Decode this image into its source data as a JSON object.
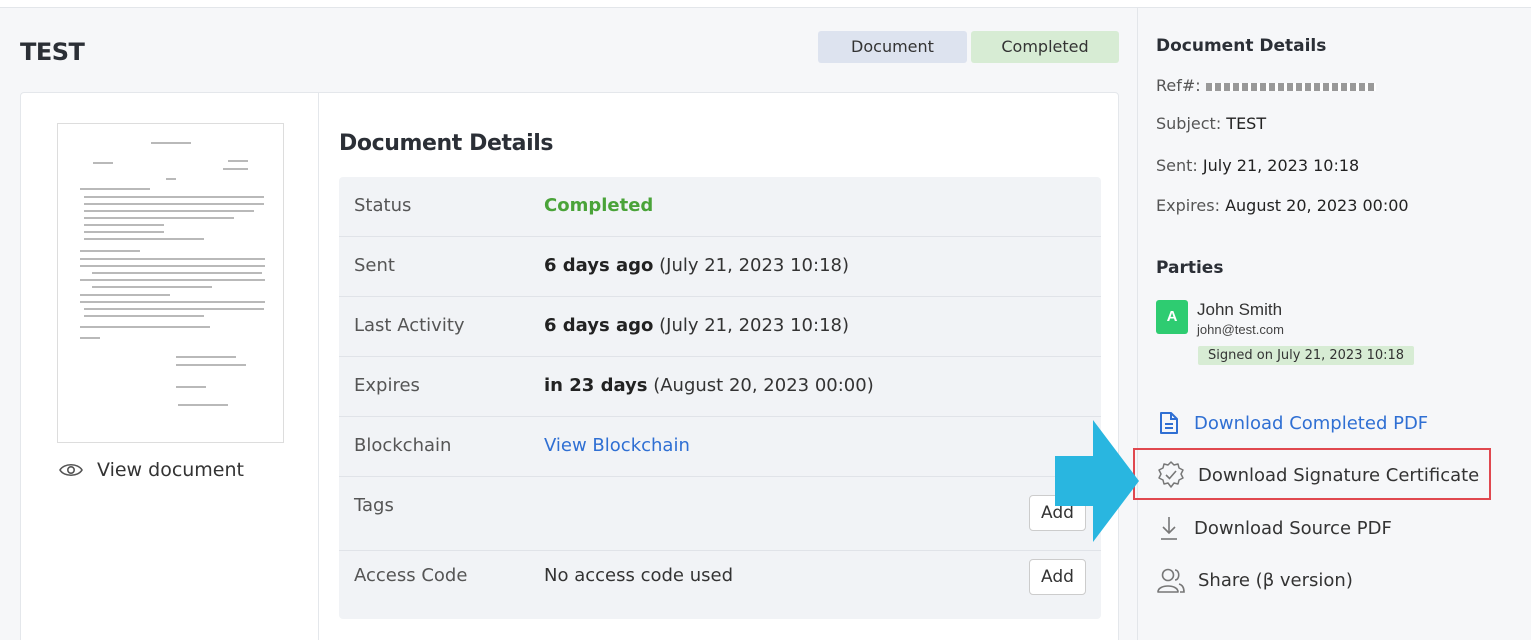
{
  "header": {
    "title": "TEST",
    "badge_type": "Document",
    "badge_status": "Completed"
  },
  "preview": {
    "view_label": "View document"
  },
  "details": {
    "heading": "Document Details",
    "rows": [
      {
        "label": "Status",
        "value": "Completed"
      },
      {
        "label": "Sent",
        "value_bold": "6 days ago",
        "value_rest": " (July 21, 2023 10:18)"
      },
      {
        "label": "Last Activity",
        "value_bold": "6 days ago",
        "value_rest": " (July 21, 2023 10:18)"
      },
      {
        "label": "Expires",
        "value_bold": "in 23 days",
        "value_rest": " (August 20, 2023 00:00)"
      },
      {
        "label": "Blockchain",
        "value": "View Blockchain"
      },
      {
        "label": "Tags",
        "button": "Add"
      },
      {
        "label": "Access Code",
        "value": "No access code used",
        "button": "Add"
      }
    ]
  },
  "sidebar": {
    "heading": "Document Details",
    "ref_label": "Ref#:",
    "subject_label": "Subject:",
    "subject_value": "TEST",
    "sent_label": "Sent:",
    "sent_value": "July 21, 2023 10:18",
    "expires_label": "Expires:",
    "expires_value": "August 20, 2023 00:00",
    "parties_heading": "Parties",
    "party": {
      "initial": "A",
      "name": "John Smith",
      "email": "john@test.com",
      "signed": "Signed on July 21, 2023 10:18"
    },
    "actions": [
      {
        "label": "Download Completed PDF",
        "icon": "file-text-icon"
      },
      {
        "label": "Download Signature Certificate",
        "icon": "certificate-badge-icon"
      },
      {
        "label": "Download Source PDF",
        "icon": "download-icon"
      },
      {
        "label": "Share (β version)",
        "icon": "users-icon"
      }
    ]
  },
  "colors": {
    "accent": "#2f6fd3",
    "completed": "#4aa339",
    "highlight_border": "#e0484f",
    "arrow": "#29b6e0"
  }
}
